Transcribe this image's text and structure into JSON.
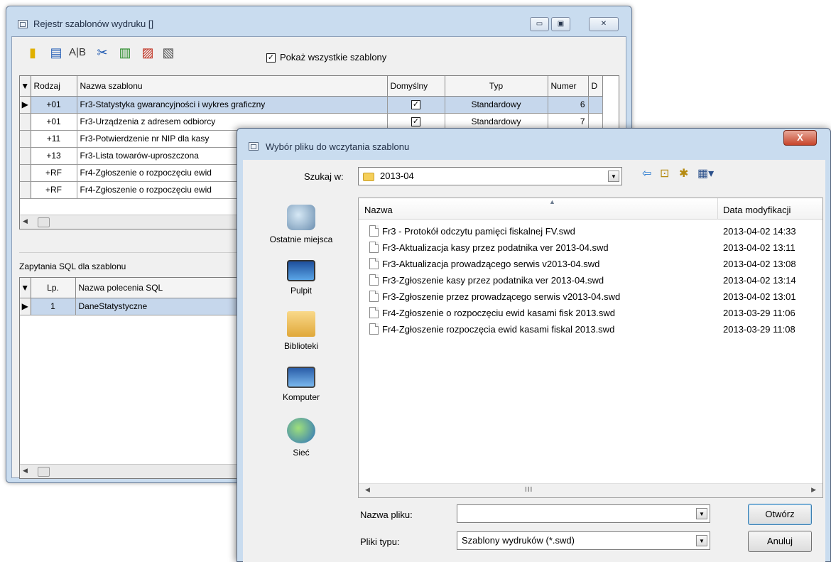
{
  "registry": {
    "title": "Rejestr szablonów wydruku []",
    "caption_buttons": {
      "minimize": "▭",
      "maximize": "▣",
      "close": "✕"
    },
    "show_all_label": "Pokaż wszystkie szablony",
    "show_all_checked": "✓",
    "columns": [
      "Rodzaj",
      "Nazwa szablonu",
      "Domyślny",
      "Typ",
      "Numer",
      "D"
    ],
    "rows": [
      {
        "indicator": "▶",
        "kind": "+01",
        "name": "Fr3-Statystyka gwarancyjności i wykres graficzny",
        "default": "✓",
        "type": "Standardowy",
        "number": "6"
      },
      {
        "indicator": "",
        "kind": "+01",
        "name": "Fr3-Urządzenia z adresem odbiorcy",
        "default": "✓",
        "type": "Standardowy",
        "number": "7"
      },
      {
        "indicator": "",
        "kind": "+11",
        "name": "Fr3-Potwierdzenie nr NIP dla kasy",
        "default": "",
        "type": "",
        "number": ""
      },
      {
        "indicator": "",
        "kind": "+13",
        "name": "Fr3-Lista towarów-uproszczona",
        "default": "",
        "type": "",
        "number": ""
      },
      {
        "indicator": "",
        "kind": "+RF",
        "name": "Fr4-Zgłoszenie o rozpoczęciu ewid",
        "default": "",
        "type": "",
        "number": ""
      },
      {
        "indicator": "",
        "kind": "+RF",
        "name": "Fr4-Zgłoszenie o rozpoczęciu ewid",
        "default": "",
        "type": "",
        "number": ""
      }
    ],
    "sql_title": "Zapytania SQL dla szablonu",
    "sql_columns": [
      "Lp.",
      "Nazwa polecenia SQL"
    ],
    "sql_rows": [
      {
        "indicator": "▶",
        "lp": "1",
        "name": "DaneStatystyczne"
      }
    ]
  },
  "dialog": {
    "title": "Wybór pliku do wczytania szablonu",
    "close": "X",
    "look_in_label": "Szukaj w:",
    "look_in_value": "2013-04",
    "places": [
      "Ostatnie miejsca",
      "Pulpit",
      "Biblioteki",
      "Komputer",
      "Sieć"
    ],
    "col_name": "Nazwa",
    "col_date": "Data modyfikacji",
    "files": [
      {
        "name": "Fr3 - Protokół odczytu pamięci fiskalnej FV.swd",
        "date": "2013-04-02 14:33"
      },
      {
        "name": "Fr3-Aktualizacja kasy przez podatnika ver 2013-04.swd",
        "date": "2013-04-02 13:11"
      },
      {
        "name": "Fr3-Aktualizacja prowadzącego serwis v2013-04.swd",
        "date": "2013-04-02 13:08"
      },
      {
        "name": "Fr3-Zgłoszenie kasy przez podatnika ver 2013-04.swd",
        "date": "2013-04-02 13:14"
      },
      {
        "name": "Fr3-Zgłoszenie przez prowadzącego serwis v2013-04.swd",
        "date": "2013-04-02 13:01"
      },
      {
        "name": "Fr4-Zgłoszenie o rozpoczęciu ewid kasami fisk 2013.swd",
        "date": "2013-03-29 11:06"
      },
      {
        "name": "Fr4-Zgłoszenie rozpoczęcia ewid kasami fiskal 2013.swd",
        "date": "2013-03-29 11:08"
      }
    ],
    "scroll_grip": "III",
    "filename_label": "Nazwa pliku:",
    "filename_value": "",
    "filetype_label": "Pliki typu:",
    "filetype_value": "Szablony wydruków (*.swd)",
    "open_button": "Otwórz",
    "cancel_button": "Anuluj"
  }
}
